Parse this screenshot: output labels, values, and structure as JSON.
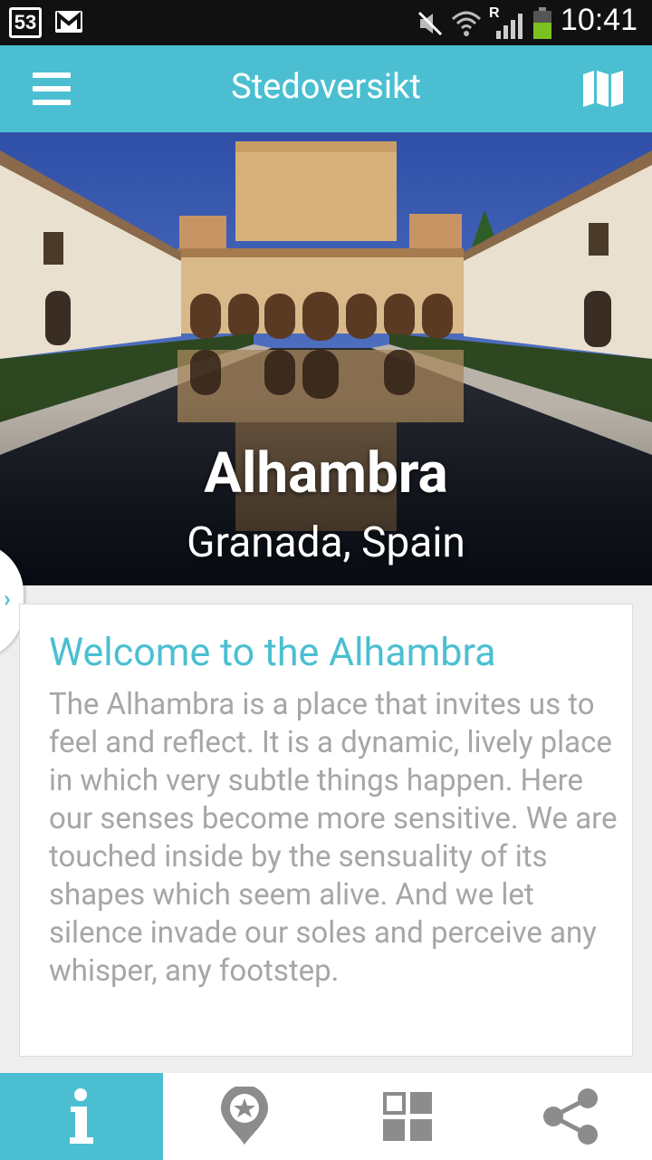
{
  "status_bar": {
    "notification_count": "53",
    "time": "10:41",
    "icons": [
      "mail-icon",
      "mute-icon",
      "wifi-icon",
      "roaming-signal-icon",
      "battery-icon"
    ],
    "roaming_label": "R"
  },
  "app_bar": {
    "title": "Stedoversikt",
    "left_icon": "menu-icon",
    "right_icon": "map-icon"
  },
  "hero": {
    "title": "Alhambra",
    "subtitle": "Granada, Spain"
  },
  "card": {
    "title": "Welcome to the Alhambra",
    "body": "The Alhambra is a place that invites us to feel and reflect. It is a dynamic, lively place in which very subtle things happen. Here our senses become more sensitive. We are touched inside by the sensuality of its shapes which seem alive. And we let silence invade our soles and perceive any whisper, any footstep."
  },
  "bottom_tabs": [
    {
      "icon": "info-icon",
      "active": true
    },
    {
      "icon": "map-pin-star-icon",
      "active": false
    },
    {
      "icon": "grid-icon",
      "active": false
    },
    {
      "icon": "share-icon",
      "active": false
    }
  ],
  "colors": {
    "accent": "#4bbfd1",
    "status_bar": "#111111",
    "body_text": "#a6a6a6",
    "icon_gray": "#8c8c8c"
  }
}
